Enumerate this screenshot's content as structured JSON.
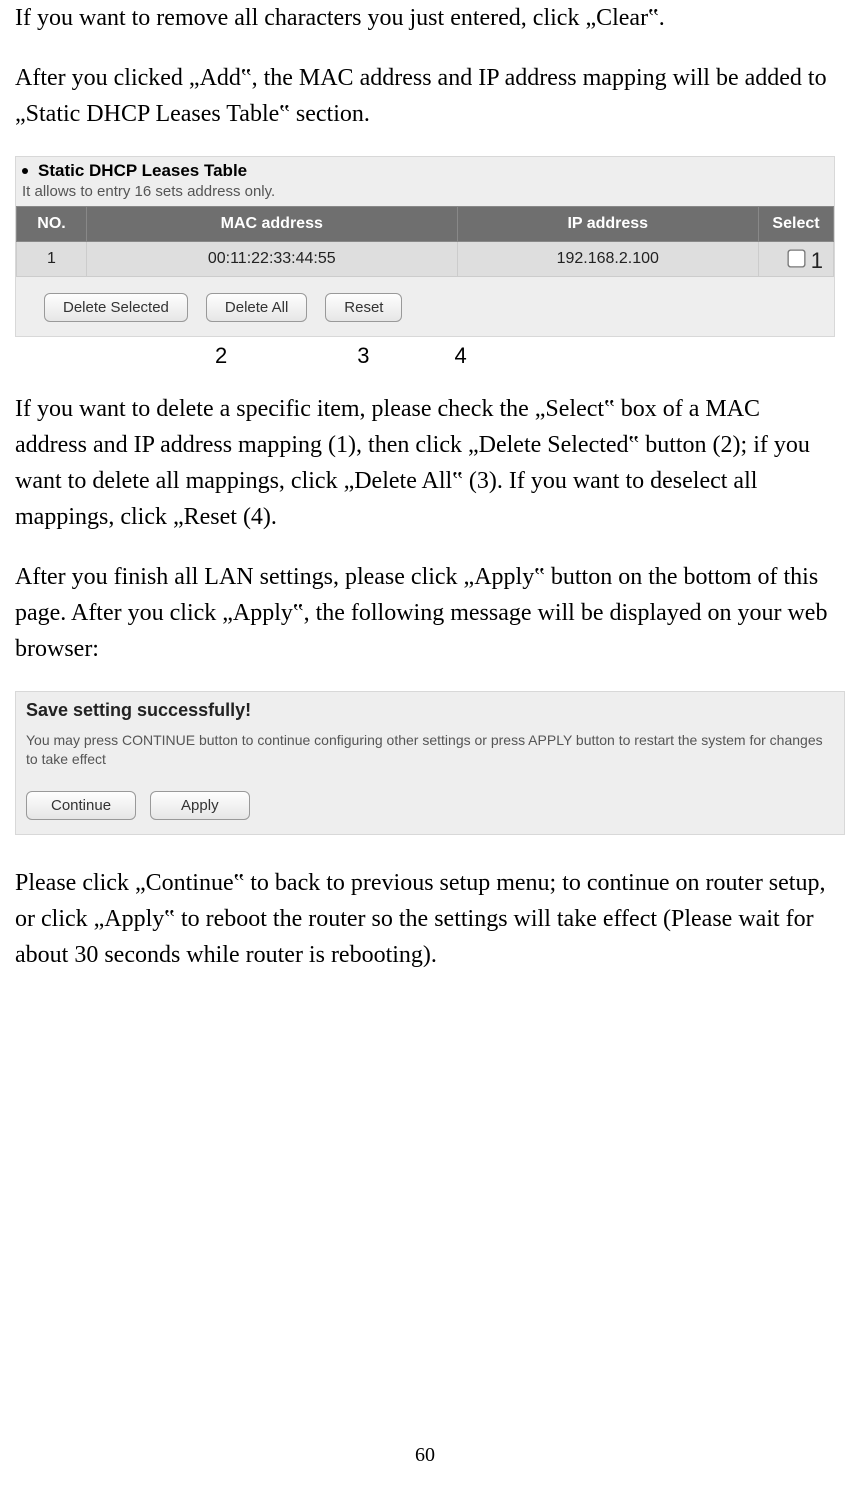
{
  "para1": "If you want to remove all characters you just entered, click „Clear‟.",
  "para2": "After you clicked „Add‟, the MAC address and IP address mapping will be added to „Static DHCP Leases Table‟ section.",
  "fig1": {
    "title": "Static DHCP Leases Table",
    "subtitle": "It allows to entry 16 sets address only.",
    "headers": {
      "no": "NO.",
      "mac": "MAC address",
      "ip": "IP address",
      "sel": "Select"
    },
    "row": {
      "no": "1",
      "mac": "00:11:22:33:44:55",
      "ip": "192.168.2.100"
    },
    "annot1": "1",
    "buttons": {
      "delSel": "Delete Selected",
      "delAll": "Delete All",
      "reset": "Reset"
    }
  },
  "callouts": {
    "c2": "2",
    "c3": "3",
    "c4": "4"
  },
  "para3": "If you want to delete a specific item, please check the „Select‟ box of a MAC address and IP address mapping (1), then click „Delete Selected‟ button (2); if you want to delete all mappings, click „Delete All‟ (3). If you want to deselect all mappings, click „Reset (4).",
  "para4": "After you finish all LAN settings, please click „Apply‟ button on the bottom of this page. After you click „Apply‟, the following message will be displayed on your web browser:",
  "fig2": {
    "title": "Save setting successfully!",
    "msg": "You may press CONTINUE button to continue configuring other settings or press APPLY button to restart the system for changes to take effect",
    "buttons": {
      "cont": "Continue",
      "apply": "Apply"
    }
  },
  "para5": "Please click „Continue‟ to back to previous setup menu; to continue on router setup, or click „Apply‟ to reboot the router so the settings will take effect (Please wait for about 30 seconds while router is rebooting).",
  "pageNum": "60"
}
